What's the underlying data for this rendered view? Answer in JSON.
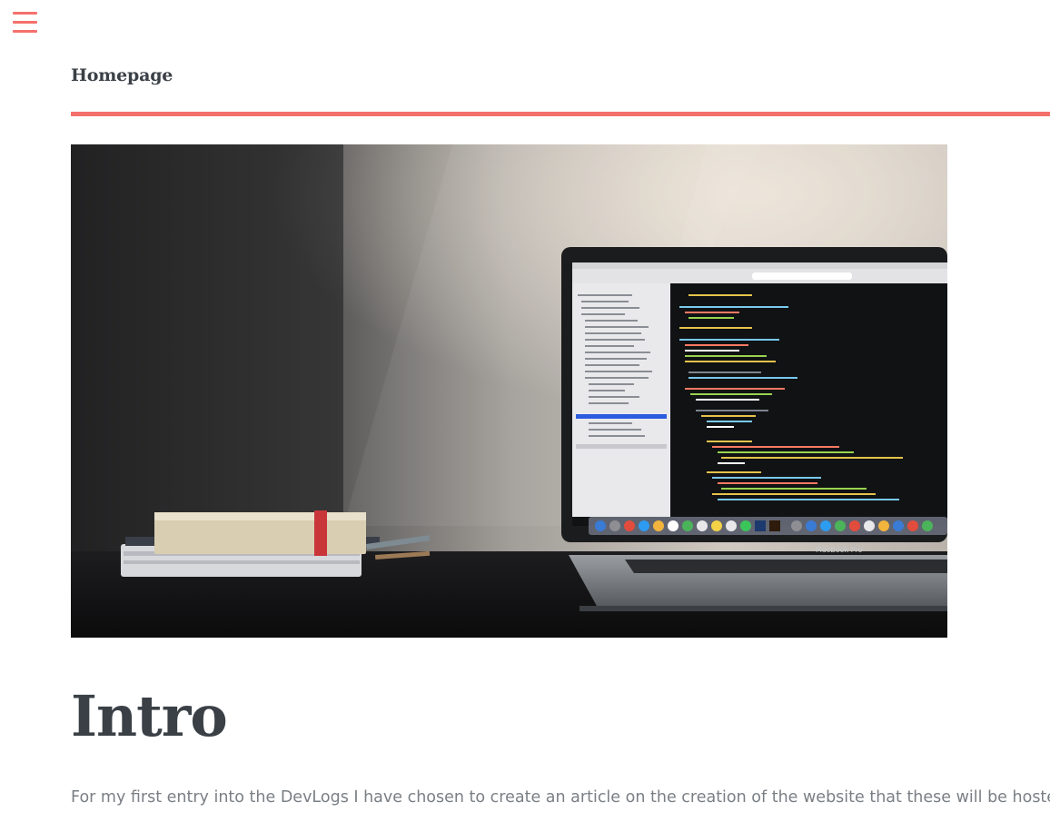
{
  "nav": {
    "menu_icon": "hamburger-menu-icon",
    "accent_color": "#f4716b"
  },
  "header": {
    "title": "Homepage"
  },
  "hero": {
    "image_subject": "laptop-and-books-on-desk-photo",
    "laptop_brand": "MacBook Pro"
  },
  "article": {
    "heading": "Intro",
    "paragraph": "For my first entry into the DevLogs I have chosen to create an article on the creation of the website that these will be hosted on"
  },
  "colors": {
    "accent": "#f4716b",
    "heading_text": "#3a4046",
    "body_text": "#7a7f85"
  }
}
